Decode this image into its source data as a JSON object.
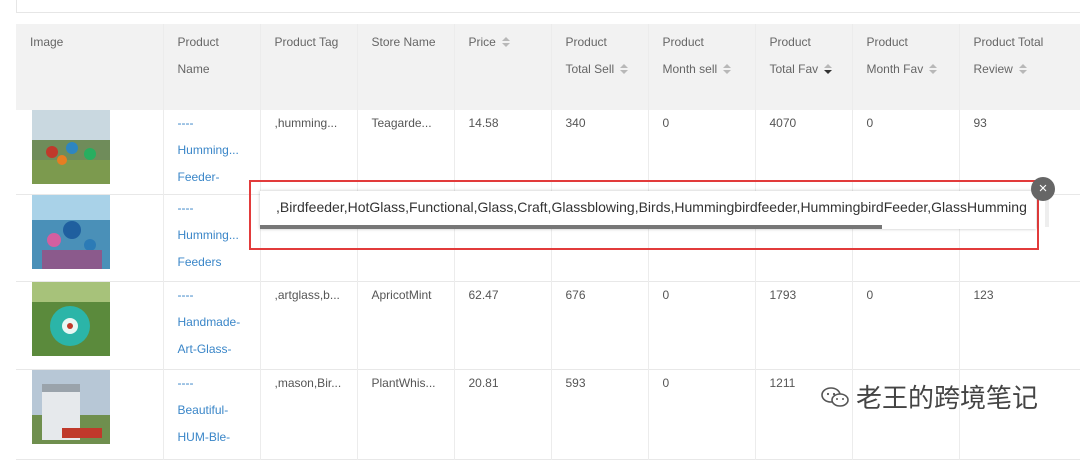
{
  "table": {
    "headers": [
      {
        "l1": "Image",
        "l2": "",
        "sort": false
      },
      {
        "l1": "Product",
        "l2": "Name",
        "sort": false
      },
      {
        "l1": "Product Tag",
        "l2": "",
        "sort": false
      },
      {
        "l1": "Store Name",
        "l2": "",
        "sort": false
      },
      {
        "l1": "Price",
        "l2": "",
        "sort": true
      },
      {
        "l1": "Product",
        "l2": "Total Sell",
        "sort": true
      },
      {
        "l1": "Product",
        "l2": "Month sell",
        "sort": true
      },
      {
        "l1": "Product",
        "l2": "Total Fav",
        "sort": true,
        "active": true
      },
      {
        "l1": "Product",
        "l2": "Month Fav",
        "sort": true
      },
      {
        "l1": "Product Total",
        "l2": "Review",
        "sort": true
      }
    ],
    "rows": [
      {
        "name": [
          "----",
          "Humming...",
          "Feeder-"
        ],
        "tag": ",humming...",
        "store": "Teagarde...",
        "price": "14.58",
        "total_sell": "340",
        "month_sell": "0",
        "total_fav": "4070",
        "month_fav": "0",
        "review": "93"
      },
      {
        "name": [
          "----",
          "Humming...",
          "Feeders"
        ],
        "tag": "",
        "store": "",
        "price": "",
        "total_sell": "",
        "month_sell": "",
        "total_fav": "",
        "month_fav": "",
        "review": ""
      },
      {
        "name": [
          "----",
          "Handmade-",
          "Art-Glass-"
        ],
        "tag": ",artglass,b...",
        "store": "ApricotMint",
        "price": "62.47",
        "total_sell": "676",
        "month_sell": "0",
        "total_fav": "1793",
        "month_fav": "0",
        "review": "123"
      },
      {
        "name": [
          "----",
          "Beautiful-",
          "HUM-Ble-"
        ],
        "tag": ",mason,Bir...",
        "store": "PlantWhis...",
        "price": "20.81",
        "total_sell": "593",
        "month_sell": "0",
        "total_fav": "1211",
        "month_fav": "",
        "review": ""
      }
    ]
  },
  "popup": {
    "text": ",Birdfeeder,HotGlass,Functional,Glass,Craft,Glassblowing,Birds,Hummingbirdfeeder,HummingbirdFeeder,GlassHumming",
    "close_symbol": "×",
    "highlight_color": "#e23b3b"
  },
  "watermark": {
    "text": "老王的跨境笔记",
    "icon": "wechat-icon"
  },
  "colors": {
    "link": "#3a86c8",
    "header_bg": "#f2f2f2"
  }
}
